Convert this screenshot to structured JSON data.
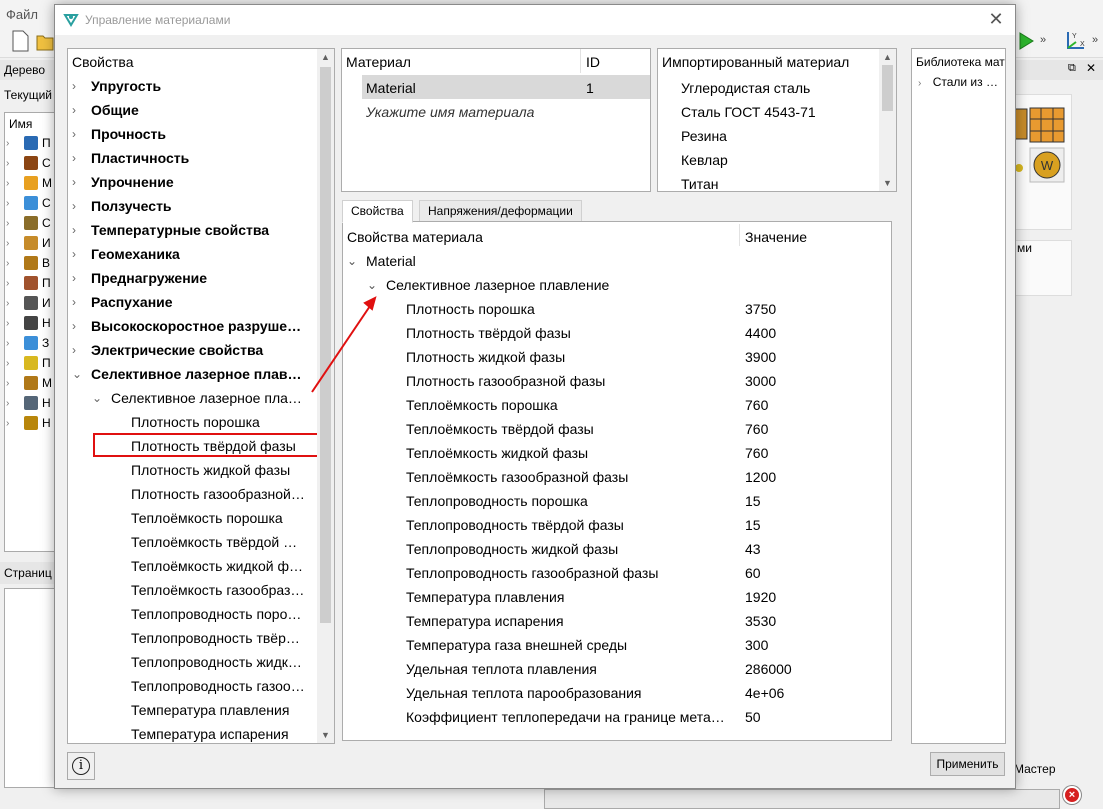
{
  "app": {
    "menu_file": "Файл",
    "left_dock_title": "Дерево",
    "current_label": "Текущий",
    "tree_header": "Имя",
    "page_dock_title": "Страниц",
    "right_box2_text": "ми",
    "master_label": "Мастер",
    "left_tree_rows": [
      {
        "icon": "bolt-icon",
        "color": "#2a6ab3",
        "text": "П"
      },
      {
        "icon": "si-units-icon",
        "color": "#8b4513",
        "text": "С"
      },
      {
        "icon": "material-spheres-icon",
        "color": "#e8a020",
        "text": "М"
      },
      {
        "icon": "chart-icon",
        "color": "#3c8fd8",
        "text": "С"
      },
      {
        "icon": "beam-icon",
        "color": "#8a6d2a",
        "text": "С"
      },
      {
        "icon": "box-icon",
        "color": "#c68b2a",
        "text": "И"
      },
      {
        "icon": "cube-icon",
        "color": "#b07818",
        "text": "В"
      },
      {
        "icon": "ruler-icon",
        "color": "#a0522d",
        "text": "П"
      },
      {
        "icon": "antenna-icon",
        "color": "#555555",
        "text": "И"
      },
      {
        "icon": "t0-icon",
        "color": "#444444",
        "text": "Н"
      },
      {
        "icon": "graph-icon",
        "color": "#3c8fd8",
        "text": "З"
      },
      {
        "icon": "molecules-icon",
        "color": "#d8b820",
        "text": "П"
      },
      {
        "icon": "grid-icon",
        "color": "#b07818",
        "text": "М"
      },
      {
        "icon": "tool-icon",
        "color": "#556677",
        "text": "Н"
      },
      {
        "icon": "wave-icon",
        "color": "#b8860b",
        "text": "Н"
      }
    ]
  },
  "dialog": {
    "title": "Управление материалами",
    "props_header": "Свойства",
    "props_tree": [
      {
        "label": "Упругость",
        "bold": true,
        "arrow": "›",
        "indent": 0
      },
      {
        "label": "Общие",
        "bold": true,
        "arrow": "›",
        "indent": 0
      },
      {
        "label": "Прочность",
        "bold": true,
        "arrow": "›",
        "indent": 0
      },
      {
        "label": "Пластичность",
        "bold": true,
        "arrow": "›",
        "indent": 0
      },
      {
        "label": "Упрочнение",
        "bold": true,
        "arrow": "›",
        "indent": 0
      },
      {
        "label": "Ползучесть",
        "bold": true,
        "arrow": "›",
        "indent": 0
      },
      {
        "label": "Температурные свойства",
        "bold": true,
        "arrow": "›",
        "indent": 0
      },
      {
        "label": "Геомеханика",
        "bold": true,
        "arrow": "›",
        "indent": 0
      },
      {
        "label": "Преднагружение",
        "bold": true,
        "arrow": "›",
        "indent": 0
      },
      {
        "label": "Распухание",
        "bold": true,
        "arrow": "›",
        "indent": 0
      },
      {
        "label": "Высокоскоростное разруше…",
        "bold": true,
        "arrow": "›",
        "indent": 0
      },
      {
        "label": "Электрические свойства",
        "bold": true,
        "arrow": "›",
        "indent": 0
      },
      {
        "label": "Селективное лазерное плав…",
        "bold": true,
        "arrow": "⌄",
        "indent": 0
      },
      {
        "label": "Селективное лазерное пла…",
        "bold": false,
        "arrow": "⌄",
        "indent": 1
      },
      {
        "label": "Плотность порошка",
        "bold": false,
        "arrow": "",
        "indent": 2
      },
      {
        "label": "Плотность твёрдой фазы",
        "bold": false,
        "arrow": "",
        "indent": 2
      },
      {
        "label": "Плотность жидкой фазы",
        "bold": false,
        "arrow": "",
        "indent": 2
      },
      {
        "label": "Плотность газообразной…",
        "bold": false,
        "arrow": "",
        "indent": 2
      },
      {
        "label": "Теплоёмкость порошка",
        "bold": false,
        "arrow": "",
        "indent": 2
      },
      {
        "label": "Теплоёмкость твёрдой …",
        "bold": false,
        "arrow": "",
        "indent": 2
      },
      {
        "label": "Теплоёмкость жидкой ф…",
        "bold": false,
        "arrow": "",
        "indent": 2
      },
      {
        "label": "Теплоёмкость газообраз…",
        "bold": false,
        "arrow": "",
        "indent": 2
      },
      {
        "label": "Теплопроводность поро…",
        "bold": false,
        "arrow": "",
        "indent": 2
      },
      {
        "label": "Теплопроводность твёр…",
        "bold": false,
        "arrow": "",
        "indent": 2
      },
      {
        "label": "Теплопроводность жидк…",
        "bold": false,
        "arrow": "",
        "indent": 2
      },
      {
        "label": "Теплопроводность газоо…",
        "bold": false,
        "arrow": "",
        "indent": 2
      },
      {
        "label": "Температура плавления",
        "bold": false,
        "arrow": "",
        "indent": 2
      },
      {
        "label": "Температура испарения",
        "bold": false,
        "arrow": "",
        "indent": 2
      }
    ],
    "material_table": {
      "col_name": "Материал",
      "col_id": "ID",
      "name": "Material",
      "id": "1",
      "placeholder": "Укажите имя материала"
    },
    "imported": {
      "header": "Импортированный материал",
      "items": [
        "Углеродистая сталь",
        "Сталь ГОСТ 4543-71",
        "Резина",
        "Кевлар",
        "Титан"
      ]
    },
    "tabs": [
      {
        "label": "Свойства",
        "active": true
      },
      {
        "label": "Напряжения/деформации",
        "active": false
      }
    ],
    "props_table": {
      "col_prop": "Свойства материала",
      "col_value": "Значение",
      "material": "Material",
      "group": "Селективное лазерное плавление",
      "rows": [
        {
          "name": "Плотность порошка",
          "value": "3750"
        },
        {
          "name": "Плотность твёрдой фазы",
          "value": "4400"
        },
        {
          "name": "Плотность жидкой фазы",
          "value": "3900"
        },
        {
          "name": "Плотность газообразной фазы",
          "value": "3000"
        },
        {
          "name": "Теплоёмкость порошка",
          "value": "760"
        },
        {
          "name": "Теплоёмкость твёрдой фазы",
          "value": "760"
        },
        {
          "name": "Теплоёмкость жидкой фазы",
          "value": "760"
        },
        {
          "name": "Теплоёмкость газообразной фазы",
          "value": "1200"
        },
        {
          "name": "Теплопроводность порошка",
          "value": "15"
        },
        {
          "name": "Теплопроводность твёрдой фазы",
          "value": "15"
        },
        {
          "name": "Теплопроводность жидкой фазы",
          "value": "43"
        },
        {
          "name": "Теплопроводность газообразной фазы",
          "value": "60"
        },
        {
          "name": "Температура плавления",
          "value": "1920"
        },
        {
          "name": "Температура испарения",
          "value": "3530"
        },
        {
          "name": "Температура газа внешней среды",
          "value": "300"
        },
        {
          "name": "Удельная теплота плавления",
          "value": "286000"
        },
        {
          "name": "Удельная теплота парообразования",
          "value": "4e+06"
        },
        {
          "name": "Коэффициент теплопередачи на границе мета…",
          "value": "50"
        }
      ]
    },
    "library": {
      "header": "Библиотека матер",
      "item": "Стали из …"
    },
    "apply_label": "Применить",
    "info_glyph": "i"
  },
  "colors": {
    "annotation_red": "#e01010",
    "selection_gray": "#d9d9d9"
  }
}
